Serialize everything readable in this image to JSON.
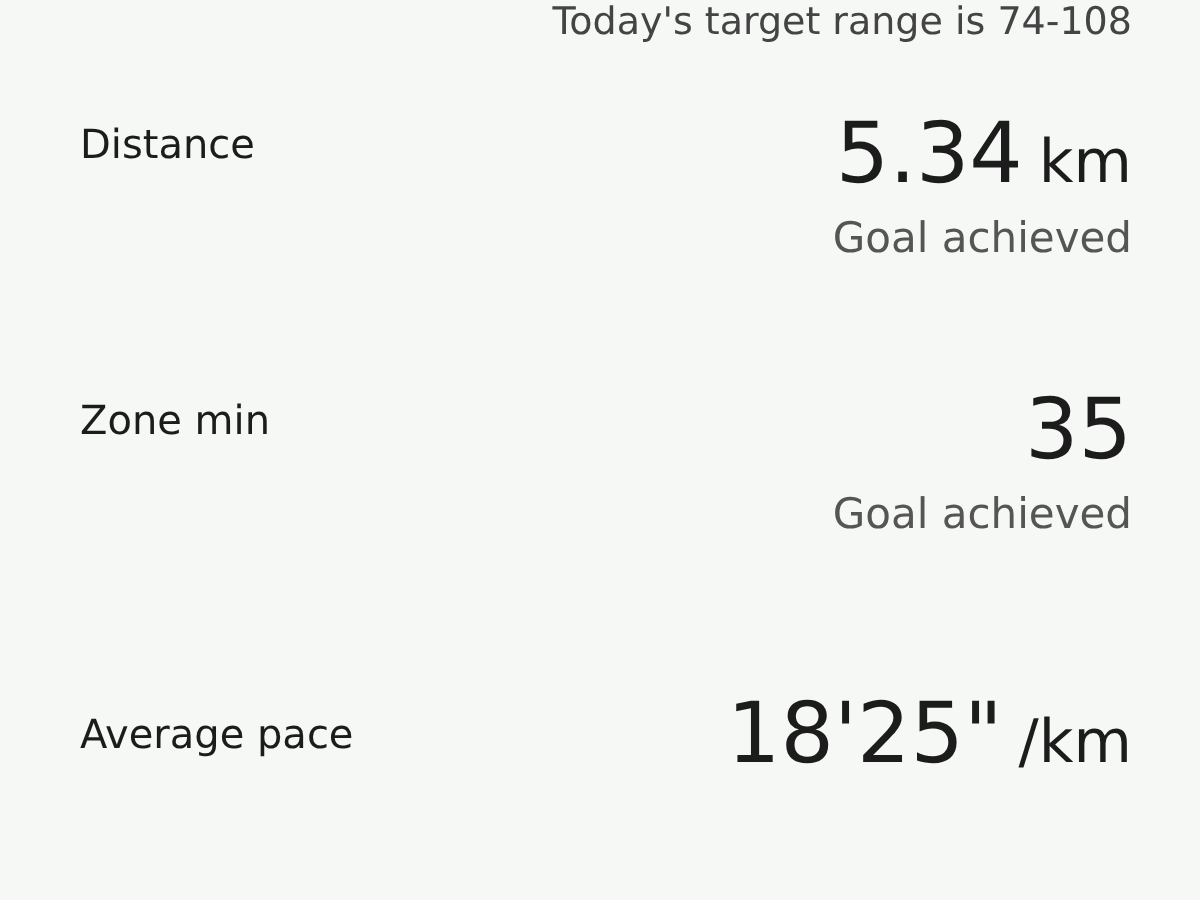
{
  "target_range": "Today's target range is 74-108",
  "metrics": [
    {
      "label": "Distance",
      "value": "5.34",
      "unit": "km",
      "note": "Goal achieved"
    },
    {
      "label": "Zone min",
      "value": "35",
      "note": "Goal achieved"
    },
    {
      "label": "Average pace",
      "value": "18'25\"",
      "unit": "/km"
    }
  ]
}
